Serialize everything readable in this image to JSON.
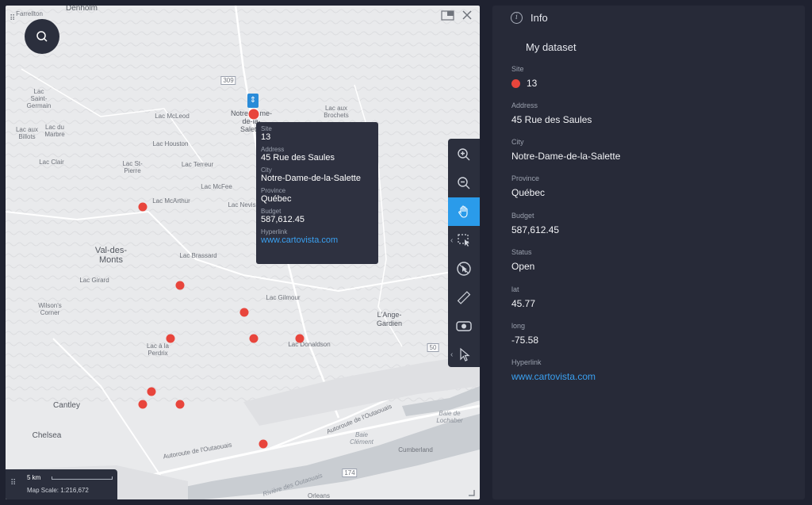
{
  "map": {
    "places": [
      {
        "text": "Farrellton",
        "cls": "small"
      },
      {
        "text": "Denholm",
        "cls": "small"
      },
      {
        "text": "Lac\nSaint-\nGermain",
        "cls": "small"
      },
      {
        "text": "Lac aux\nBillots",
        "cls": "small"
      },
      {
        "text": "Lac du\nMarbre",
        "cls": "small"
      },
      {
        "text": "Lac McLeod",
        "cls": "small"
      },
      {
        "text": "Notre-Dame-\nde-la-\nSalette",
        "cls": "small"
      },
      {
        "text": "Lac aux\nBrochets",
        "cls": "small"
      },
      {
        "text": "Lac Houston",
        "cls": "small"
      },
      {
        "text": "Lac Clair",
        "cls": "small"
      },
      {
        "text": "Lac St-\nPierre",
        "cls": "small"
      },
      {
        "text": "Lac Terreur",
        "cls": "small"
      },
      {
        "text": "Lac McFee",
        "cls": "small"
      },
      {
        "text": "Lac McArthur",
        "cls": "small"
      },
      {
        "text": "Lac Nevis",
        "cls": "small"
      },
      {
        "text": "Val-des-\nMonts",
        "cls": "big"
      },
      {
        "text": "Lac Brassard",
        "cls": "small"
      },
      {
        "text": "Lac Girard",
        "cls": "small"
      },
      {
        "text": "Wilson's\nCorner",
        "cls": "small"
      },
      {
        "text": "Lac Gilmour",
        "cls": "small"
      },
      {
        "text": "L'Ange-\nGardien",
        "cls": "small"
      },
      {
        "text": "Lac à la\nPerdrix",
        "cls": "small"
      },
      {
        "text": "Lac Donaldson",
        "cls": "small"
      },
      {
        "text": "Cantley",
        "cls": "big"
      },
      {
        "text": "Chelsea",
        "cls": "big"
      },
      {
        "text": "Autoroute de l'Outaouais",
        "cls": "small"
      },
      {
        "text": "Autoroute de l'Outaouais",
        "cls": "small"
      },
      {
        "text": "Baie de\nLochaber",
        "cls": "water"
      },
      {
        "text": "Baie\nClément",
        "cls": "water"
      },
      {
        "text": "Cumberland",
        "cls": "small"
      },
      {
        "text": "Rivière des Outaouais",
        "cls": "water"
      },
      {
        "text": "Orleans",
        "cls": "small"
      },
      {
        "text": "309",
        "cls": "small"
      },
      {
        "text": "50",
        "cls": "small"
      },
      {
        "text": "174",
        "cls": "small"
      }
    ],
    "sites_count": 11,
    "marker_glyph": "⇕",
    "tooltip": {
      "fields": [
        {
          "label": "Site",
          "value": "13"
        },
        {
          "label": "Address",
          "value": "45 Rue des Saules"
        },
        {
          "label": "City",
          "value": "Notre-Dame-de-la-Salette"
        },
        {
          "label": "Province",
          "value": "Québec"
        },
        {
          "label": "Budget",
          "value": "587,612.45"
        },
        {
          "label": "Hyperlink",
          "value": "www.cartovista.com",
          "link": true
        }
      ]
    },
    "toolbar": [
      {
        "name": "zoom-in-icon",
        "active": false
      },
      {
        "name": "zoom-out-icon",
        "active": false
      },
      {
        "name": "pan-hand-icon",
        "active": true
      },
      {
        "name": "box-select-icon",
        "active": false,
        "chevron": true
      },
      {
        "name": "identify-icon",
        "active": false
      },
      {
        "name": "measure-ruler-icon",
        "active": false
      },
      {
        "name": "camera-icon",
        "active": false
      },
      {
        "name": "pointer-icon",
        "active": false,
        "chevron": true
      }
    ],
    "scale": {
      "distance": "5 km",
      "text": "Map Scale: 1:216,672"
    }
  },
  "info": {
    "title": "Info",
    "dataset": "My dataset",
    "fields": [
      {
        "label": "Site",
        "value": "13",
        "dot": true
      },
      {
        "label": "Address",
        "value": "45 Rue des Saules"
      },
      {
        "label": "City",
        "value": "Notre-Dame-de-la-Salette"
      },
      {
        "label": "Province",
        "value": "Québec"
      },
      {
        "label": "Budget",
        "value": "587,612.45"
      },
      {
        "label": "Status",
        "value": "Open"
      },
      {
        "label": "lat",
        "value": "45.77"
      },
      {
        "label": "long",
        "value": "-75.58"
      },
      {
        "label": "Hyperlink",
        "value": "www.cartovista.com",
        "link": true
      }
    ]
  },
  "colors": {
    "site": "#e8453c",
    "accent": "#2a9bea",
    "link": "#3aa0f0",
    "panel": "#272a38"
  }
}
